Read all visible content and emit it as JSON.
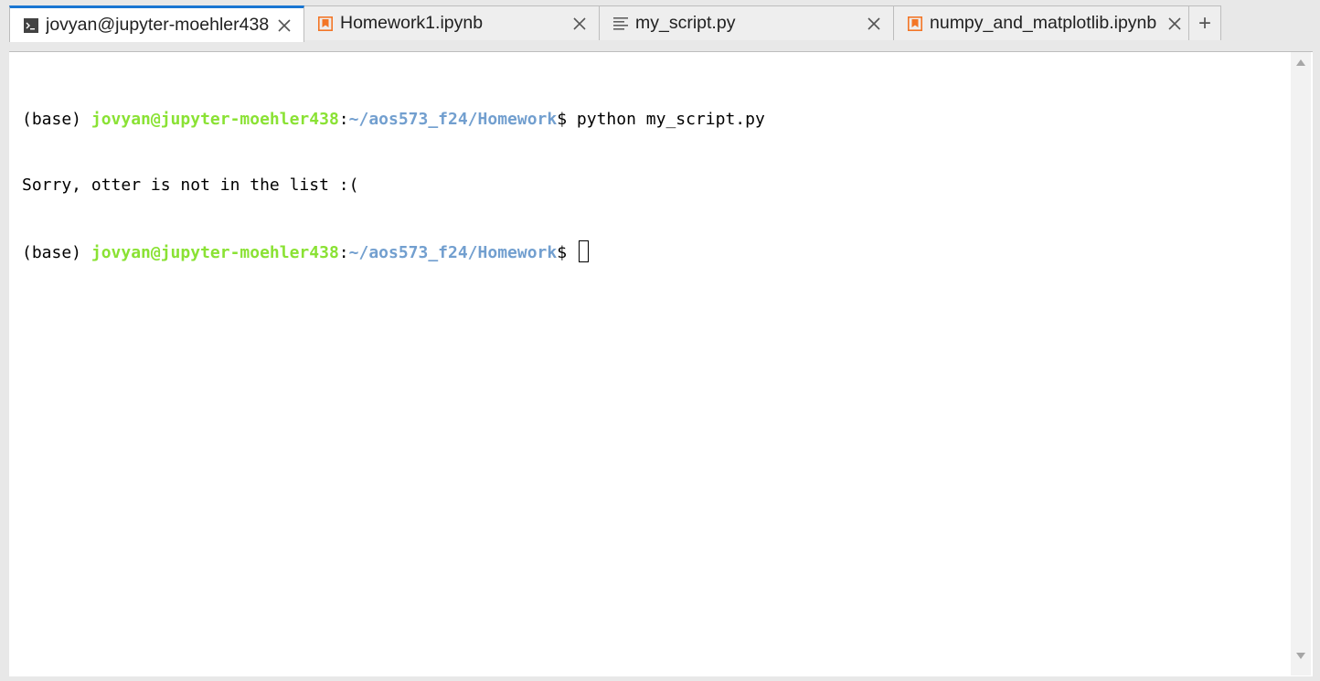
{
  "tabs": [
    {
      "label": "jovyan@jupyter-moehler438",
      "icon": "terminal-icon",
      "active": true
    },
    {
      "label": "Homework1.ipynb",
      "icon": "notebook-icon",
      "active": false
    },
    {
      "label": "my_script.py",
      "icon": "text-file-icon",
      "active": false
    },
    {
      "label": "numpy_and_matplotlib.ipynb",
      "icon": "notebook-icon",
      "active": false
    }
  ],
  "add_tab_symbol": "+",
  "colors": {
    "active_tab_accent": "#1976d2",
    "notebook_icon": "#f37626",
    "prompt_user": "#8ae234",
    "prompt_path": "#729fcf"
  },
  "terminal": {
    "env": "(base) ",
    "user_host": "jovyan@jupyter-moehler438",
    "separator": ":",
    "path": "~/aos573_f24/Homework",
    "prompt_symbol": "$ ",
    "command": "python my_script.py",
    "output": "Sorry, otter is not in the list :("
  }
}
